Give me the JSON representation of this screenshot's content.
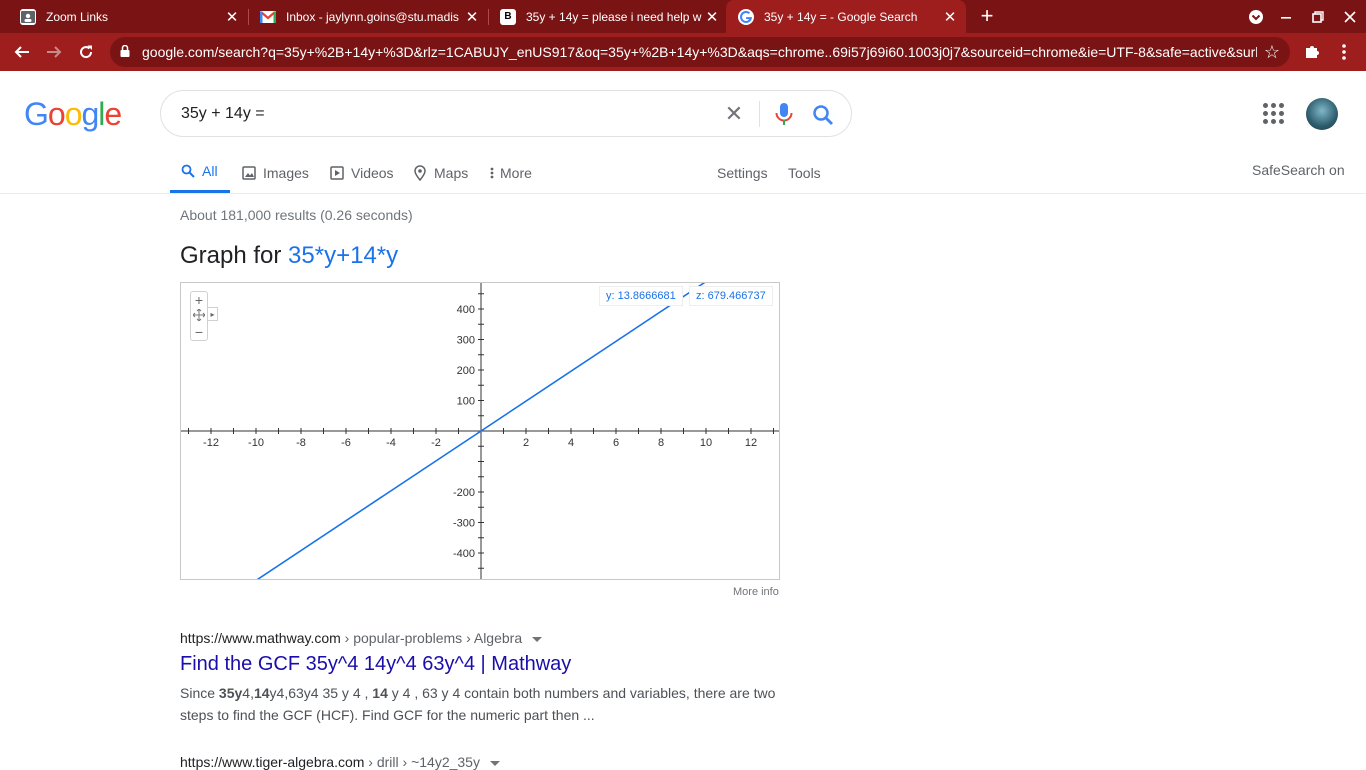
{
  "browser": {
    "tabs": [
      {
        "title": "Zoom Links",
        "favicon": "zoom-links-icon"
      },
      {
        "title": "Inbox - jaylynn.goins@stu.madis",
        "favicon": "gmail-icon"
      },
      {
        "title": "35y + 14y = please i need help w",
        "favicon": "brainly-icon"
      },
      {
        "title": "35y + 14y = - Google Search",
        "favicon": "google-g-icon"
      }
    ],
    "url": "google.com/search?q=35y+%2B+14y+%3D&rlz=1CABUJY_enUS917&oq=35y+%2B+14y+%3D&aqs=chrome..69i57j69i60.1003j0j7&sourceid=chrome&ie=UTF-8&safe=active&surl..."
  },
  "google": {
    "logo": [
      "G",
      "o",
      "o",
      "g",
      "l",
      "e"
    ],
    "logo_colors": [
      "#4285F4",
      "#EA4335",
      "#FBBC05",
      "#4285F4",
      "#34A853",
      "#EA4335"
    ],
    "query": "35y + 14y ="
  },
  "nav": {
    "all": "All",
    "images": "Images",
    "videos": "Videos",
    "maps": "Maps",
    "more": "More",
    "settings": "Settings",
    "tools": "Tools",
    "safesearch": "SafeSearch on"
  },
  "stats": "About 181,000 results (0.26 seconds)",
  "graph": {
    "title_prefix": "Graph for ",
    "function": "35*y+14*y",
    "y_readout": "y: 13.8666681",
    "z_readout": "z: 679.466737",
    "more_info": "More info",
    "zoom_in": "+",
    "zoom_out": "−"
  },
  "chart_data": {
    "type": "line",
    "title": "Graph for 35*y+14*y",
    "xlabel": "",
    "ylabel": "",
    "xlim": [
      -13.2,
      13.2
    ],
    "ylim": [
      -500,
      500
    ],
    "x_ticks": [
      -12,
      -10,
      -8,
      -6,
      -4,
      -2,
      2,
      4,
      6,
      8,
      10,
      12
    ],
    "y_ticks": [
      400,
      300,
      200,
      100,
      -200,
      -300,
      -400
    ],
    "y_tick_labels_partial": {
      "top": "500",
      "bottom": "-500"
    },
    "series": [
      {
        "slope": 49,
        "x": [
          -13.2,
          13.2
        ],
        "y": [
          -646.8,
          646.8
        ],
        "color": "#1a73e8"
      }
    ],
    "grid": false
  },
  "results": [
    {
      "site": "https://www.mathway.com",
      "breadcrumb": " › popular-problems › Algebra",
      "title": "Find the GCF 35y^4 14y^4 63y^4 | Mathway",
      "snippet_parts": [
        {
          "t": "Since ",
          "b": false
        },
        {
          "t": "35y",
          "b": true
        },
        {
          "t": "4,",
          "b": false
        },
        {
          "t": "14",
          "b": true
        },
        {
          "t": "y4,63y4 35 y 4 , ",
          "b": false
        },
        {
          "t": "14",
          "b": true
        },
        {
          "t": " y 4 , 63 y 4 contain both numbers and variables, there are two steps to find the GCF (HCF). Find GCF for the numeric part then ...",
          "b": false
        }
      ]
    },
    {
      "site": "https://www.tiger-algebra.com",
      "breadcrumb": " › drill › ~14y2_35y"
    }
  ]
}
